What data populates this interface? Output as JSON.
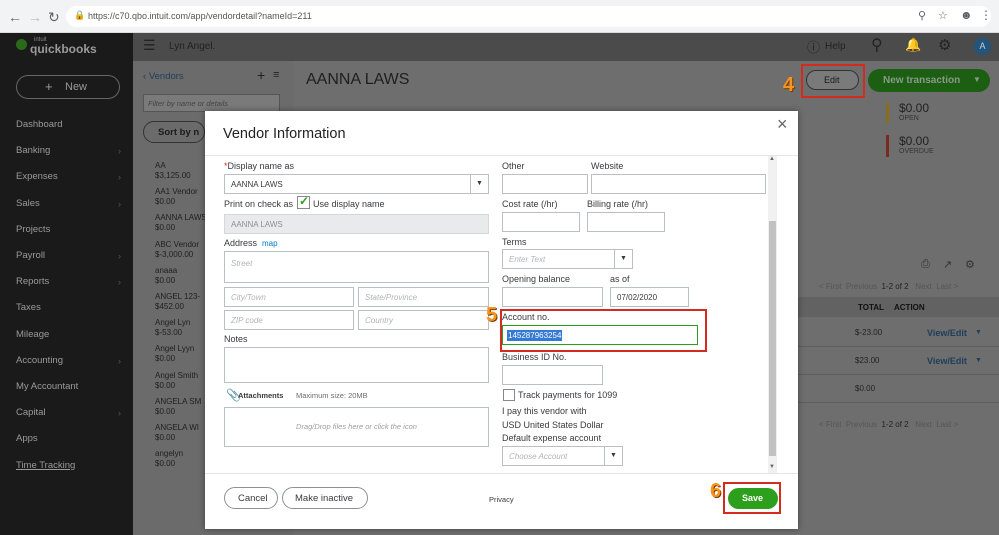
{
  "browser": {
    "url": "https://c70.qbo.intuit.com/app/vendordetail?nameId=211"
  },
  "app": {
    "logo": "quickbooks",
    "logo_small": "intuit",
    "company": "Lyn Angel.",
    "help": "Help",
    "new_button": "New",
    "nav": [
      "Dashboard",
      "Banking",
      "Expenses",
      "Sales",
      "Projects",
      "Payroll",
      "Reports",
      "Taxes",
      "Mileage",
      "Accounting",
      "My Accountant",
      "Capital",
      "Apps",
      "Time Tracking"
    ],
    "avatar": "A"
  },
  "list": {
    "back": "Vendors",
    "filter_placeholder": "Filter by name or details",
    "sort": "Sort by n",
    "vendors": [
      {
        "name": "AA",
        "amount": "$3,125.00"
      },
      {
        "name": "AA1 Vendor",
        "amount": "$0.00"
      },
      {
        "name": "AANNA LAWS",
        "amount": "$0.00"
      },
      {
        "name": "ABC Vendor",
        "amount": "$-3,000.00"
      },
      {
        "name": "anaaa",
        "amount": "$0.00"
      },
      {
        "name": "ANGEL 123-",
        "amount": "$452.00"
      },
      {
        "name": "Angel Lyn",
        "amount": "$-53.00"
      },
      {
        "name": "Angel Lyyn",
        "amount": "$0.00"
      },
      {
        "name": "Angel Smith",
        "amount": "$0.00"
      },
      {
        "name": "ANGELA SM",
        "amount": "$0.00"
      },
      {
        "name": "ANGELA WI",
        "amount": "$0.00"
      },
      {
        "name": "angelyn",
        "amount": "$0.00"
      }
    ]
  },
  "detail": {
    "title": "AANNA LAWS",
    "edit": "Edit",
    "new_transaction": "New transaction",
    "open_amount": "$0.00",
    "open_label": "OPEN",
    "overdue_amount": "$0.00",
    "overdue_label": "OVERDUE",
    "pager_first": "< First",
    "pager_prev": "Previous",
    "pager_count": "1-2 of 2",
    "pager_next": "Next",
    "pager_last": "Last >",
    "col_total": "TOTAL",
    "col_action": "ACTION",
    "rows": [
      {
        "total": "$-23.00",
        "action": "View/Edit"
      },
      {
        "total": "$23.00",
        "action": "View/Edit"
      },
      {
        "total": "$0.00",
        "action": ""
      }
    ]
  },
  "modal": {
    "title": "Vendor Information",
    "display_name_label": "Display name as",
    "display_name_value": "AANNA LAWS",
    "print_on_check_label": "Print on check as",
    "use_display_name": "Use display name",
    "print_value": "AANNA LAWS",
    "address_label": "Address",
    "map_link": "map",
    "street_ph": "Street",
    "city_ph": "City/Town",
    "state_ph": "State/Province",
    "zip_ph": "ZIP code",
    "country_ph": "Country",
    "notes_label": "Notes",
    "attachments": "Attachments",
    "max_size": "Maximum size: 20MB",
    "dropzone": "Drag/Drop files here or click the icon",
    "other_label": "Other",
    "website_label": "Website",
    "cost_rate_label": "Cost rate (/hr)",
    "billing_rate_label": "Billing rate (/hr)",
    "terms_label": "Terms",
    "terms_ph": "Enter Text",
    "opening_balance_label": "Opening balance",
    "as_of_label": "as of",
    "as_of_value": "07/02/2020",
    "account_no_label": "Account no.",
    "account_no_value": "145287963254",
    "business_id_label": "Business ID No.",
    "track_1099": "Track payments for 1099",
    "pay_with_label": "I pay this vendor with",
    "pay_with_value": "USD United States Dollar",
    "default_expense_label": "Default expense account",
    "default_expense_ph": "Choose Account",
    "cancel": "Cancel",
    "make_inactive": "Make inactive",
    "privacy": "Privacy",
    "save": "Save"
  },
  "annotations": {
    "step4": "4",
    "step5": "5",
    "step6": "6"
  },
  "colors": {
    "green": "#2ca01c",
    "annotation_red": "#d52b1e",
    "annotation_orange": "#f7941d",
    "link": "#0077c5"
  }
}
